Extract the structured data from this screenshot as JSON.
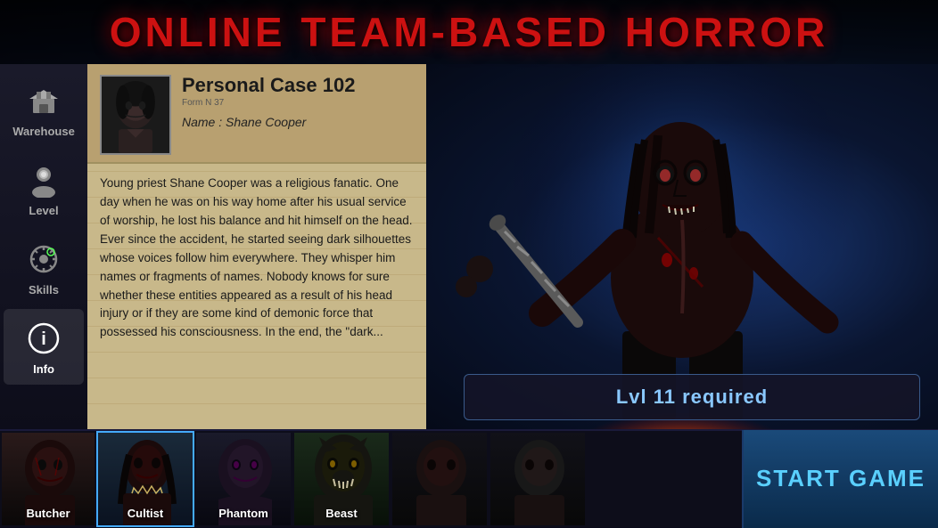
{
  "title": "ONLINE TEAM-BASED HORROR",
  "sidebar": {
    "items": [
      {
        "id": "warehouse",
        "label": "Warehouse",
        "icon": "🎒"
      },
      {
        "id": "level",
        "label": "Level",
        "icon": "👤"
      },
      {
        "id": "skills",
        "label": "Skills",
        "icon": "⚙️"
      },
      {
        "id": "info",
        "label": "Info",
        "icon": "ℹ️",
        "active": true
      }
    ]
  },
  "case": {
    "title": "Personal Case 102",
    "form_num": "Form N 37",
    "name_label": "Name : Shane Cooper",
    "body_text": "Young priest Shane Cooper was a religious fanatic. One day when he was on his way home after his usual service of worship, he lost his balance and hit himself on the head. Ever since the accident, he started seeing dark silhouettes whose voices follow him everywhere. They whisper him names or fragments of names. Nobody knows for sure whether these entities appeared as a result of his head injury or if they are some kind of demonic force that possessed his consciousness. In the end, the \"dark..."
  },
  "level_required": "Lvl 11 required",
  "characters": [
    {
      "id": "butcher",
      "label": "Butcher",
      "active": false
    },
    {
      "id": "cultist",
      "label": "Cultist",
      "active": true
    },
    {
      "id": "phantom",
      "label": "Phantom",
      "active": false
    },
    {
      "id": "beast",
      "label": "Beast",
      "active": false
    },
    {
      "id": "char5",
      "label": "",
      "active": false
    },
    {
      "id": "char6",
      "label": "",
      "active": false
    }
  ],
  "start_button": "START GAME",
  "colors": {
    "accent_blue": "#5ad0ff",
    "title_red": "#cc1111",
    "card_active_border": "#44aaff"
  }
}
